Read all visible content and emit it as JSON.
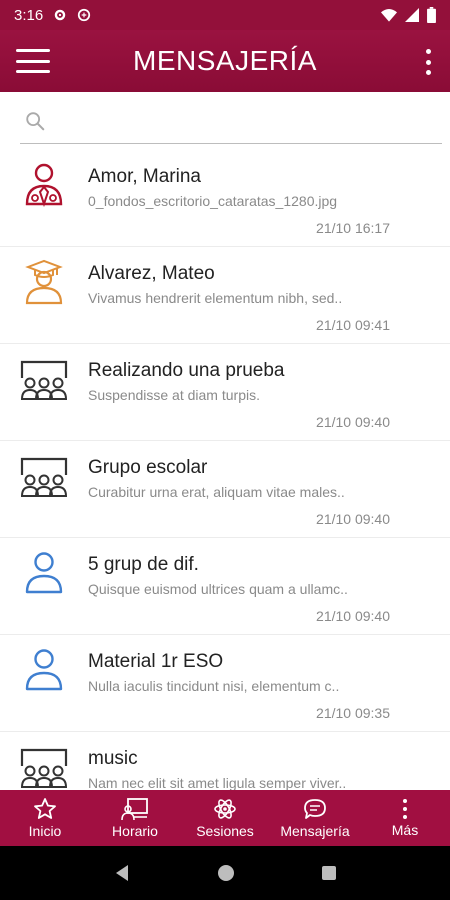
{
  "status_bar": {
    "time": "3:16"
  },
  "app_bar": {
    "title": "MENSAJERÍA"
  },
  "search": {
    "placeholder": ""
  },
  "conversations": [
    {
      "name": "Amor, Marina",
      "preview": "0_fondos_escritorio_cataratas_1280.jpg",
      "time": "21/10 16:17",
      "icon": "teacher-icon",
      "icon_color": "#b0122e"
    },
    {
      "name": "Alvarez, Mateo",
      "preview": "Vivamus hendrerit elementum nibh, sed..",
      "time": "21/10 09:41",
      "icon": "student-icon",
      "icon_color": "#e0913a"
    },
    {
      "name": "Realizando una prueba",
      "preview": "Suspendisse at diam turpis.",
      "time": "21/10 09:40",
      "icon": "group-icon",
      "icon_color": "#333333"
    },
    {
      "name": "Grupo escolar",
      "preview": "Curabitur urna erat, aliquam vitae males..",
      "time": "21/10 09:40",
      "icon": "group-icon",
      "icon_color": "#333333"
    },
    {
      "name": "5 grup de dif.",
      "preview": "Quisque euismod ultrices quam a ullamc..",
      "time": "21/10 09:40",
      "icon": "user-icon",
      "icon_color": "#3f7fd0"
    },
    {
      "name": "Material 1r ESO",
      "preview": "Nulla iaculis tincidunt nisi, elementum c..",
      "time": "21/10 09:35",
      "icon": "user-icon",
      "icon_color": "#3f7fd0"
    },
    {
      "name": "music",
      "preview": "Nam nec elit sit amet ligula semper viver..",
      "time": "",
      "icon": "group-icon",
      "icon_color": "#333333"
    }
  ],
  "bottom_nav": {
    "items": [
      {
        "label": "Inicio",
        "icon": "star-icon"
      },
      {
        "label": "Horario",
        "icon": "schedule-icon"
      },
      {
        "label": "Sesiones",
        "icon": "atom-icon"
      },
      {
        "label": "Mensajería",
        "icon": "chat-icon"
      },
      {
        "label": "Más",
        "icon": "more-vertical-icon"
      }
    ]
  },
  "colors": {
    "primary": "#9a1240",
    "nav": "#a10f41"
  }
}
